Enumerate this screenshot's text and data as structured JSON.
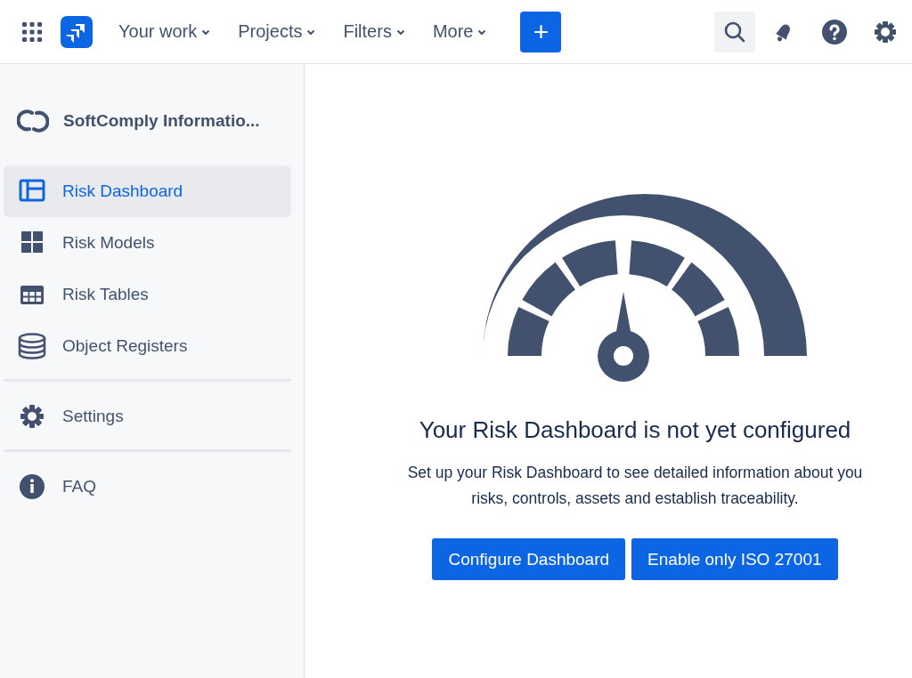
{
  "topnav": {
    "items": [
      {
        "label": "Your work"
      },
      {
        "label": "Projects"
      },
      {
        "label": "Filters"
      },
      {
        "label": "More"
      }
    ],
    "create_label": "+"
  },
  "sidebar": {
    "project": "SoftComply Informatio...",
    "items": [
      {
        "label": "Risk Dashboard",
        "kind": "dashboard",
        "selected": true
      },
      {
        "label": "Risk Models",
        "kind": "models",
        "selected": false
      },
      {
        "label": "Risk Tables",
        "kind": "tables",
        "selected": false
      },
      {
        "label": "Object Registers",
        "kind": "registers",
        "selected": false
      },
      {
        "label": "Settings",
        "kind": "settings",
        "selected": false,
        "divider_before": true
      },
      {
        "label": "FAQ",
        "kind": "faq",
        "selected": false,
        "divider_before": true
      }
    ]
  },
  "empty_state": {
    "title": "Your Risk Dashboard is not yet configured",
    "lines": [
      "Set up your Risk Dashboard to see detailed information about you",
      "risks, controls, assets and establish traceability."
    ],
    "buttons": [
      {
        "label": "Configure Dashboard"
      },
      {
        "label": "Enable only ISO 27001"
      }
    ]
  }
}
